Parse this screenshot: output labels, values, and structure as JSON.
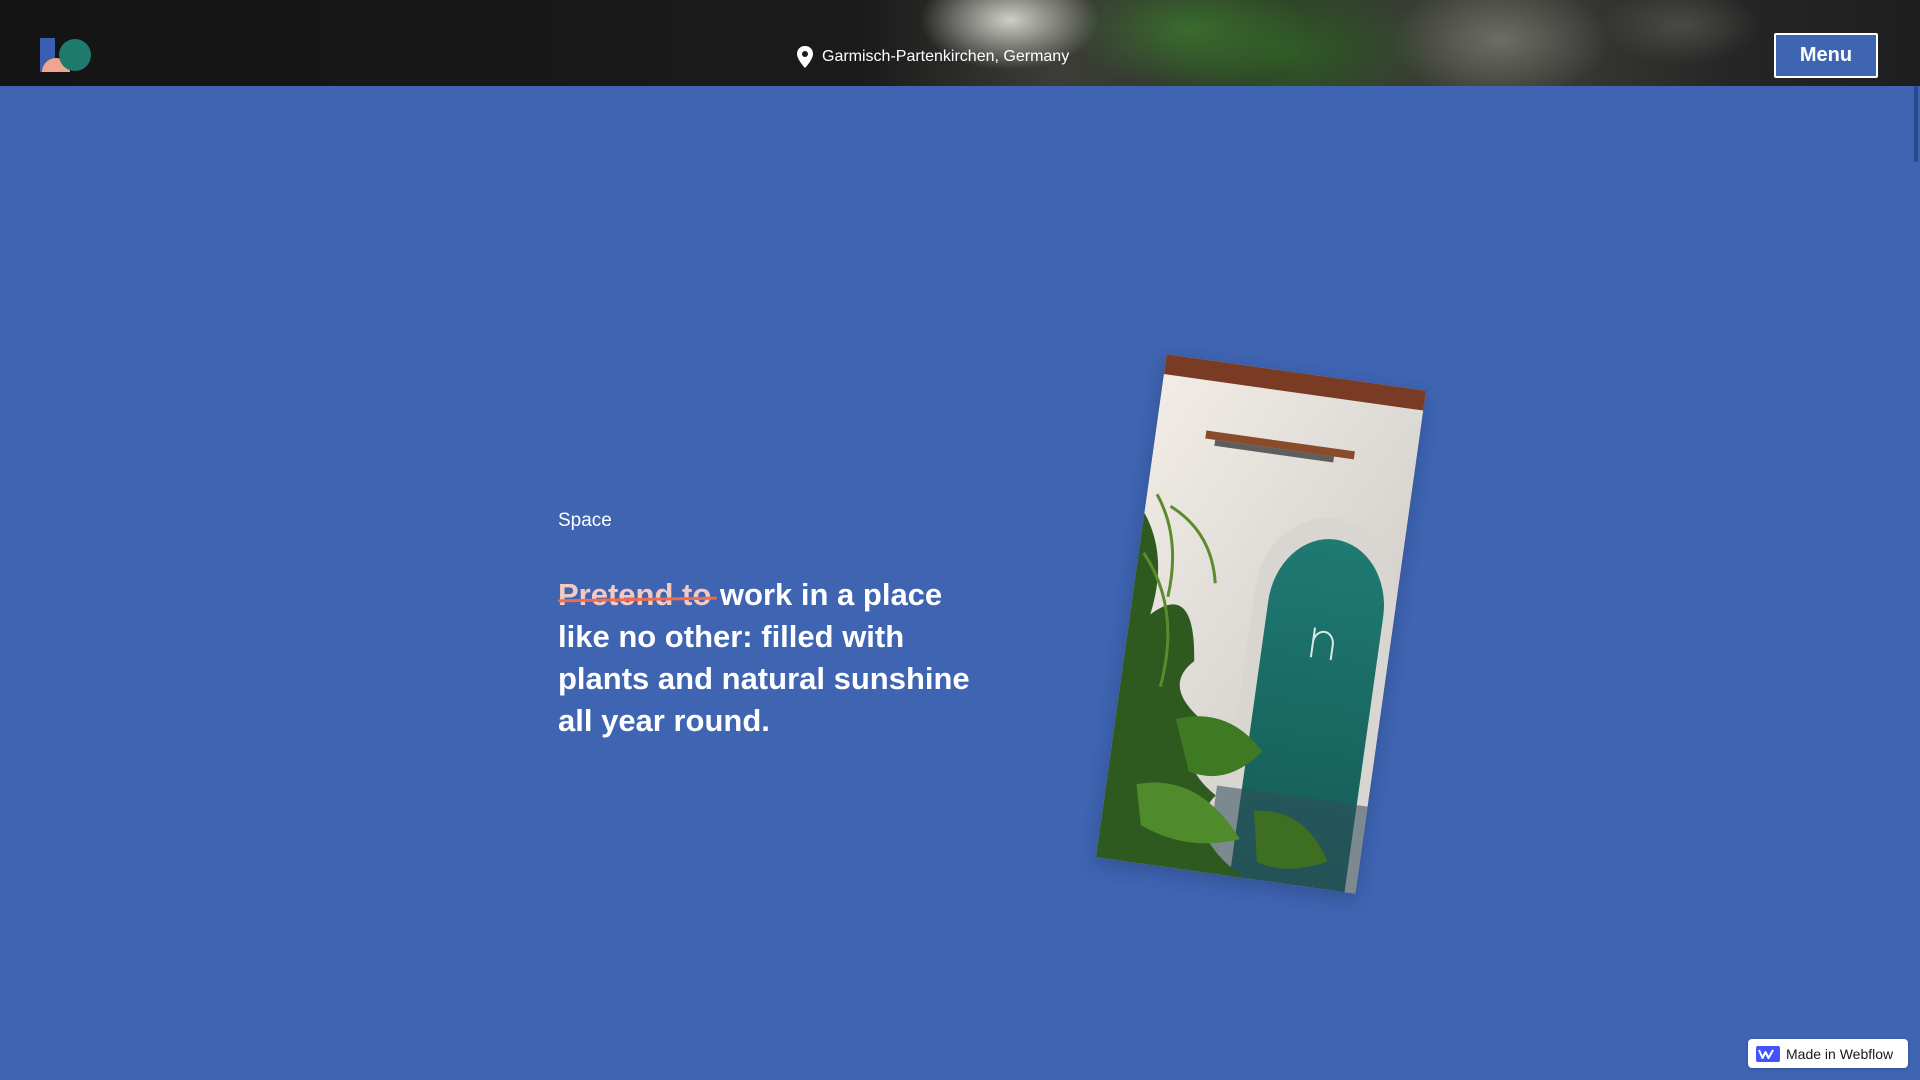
{
  "header": {
    "logo_icon": "kb-logo-icon",
    "location_icon": "map-pin-icon",
    "location": "Garmisch-Partenkirchen, Germany",
    "menu_label": "Menu"
  },
  "section": {
    "kicker": "Space",
    "headline_struck": "Pretend to",
    "headline_rest": " work in a place like no other: filled with plants and natural sunshine all year round.",
    "image_icon": "photo-arched-door-plants"
  },
  "badge": {
    "icon": "webflow-icon",
    "label": "Made in Webflow"
  },
  "colors": {
    "background": "#3e64b2",
    "accent_strike": "#ef6b4f",
    "text": "#ffffff"
  }
}
